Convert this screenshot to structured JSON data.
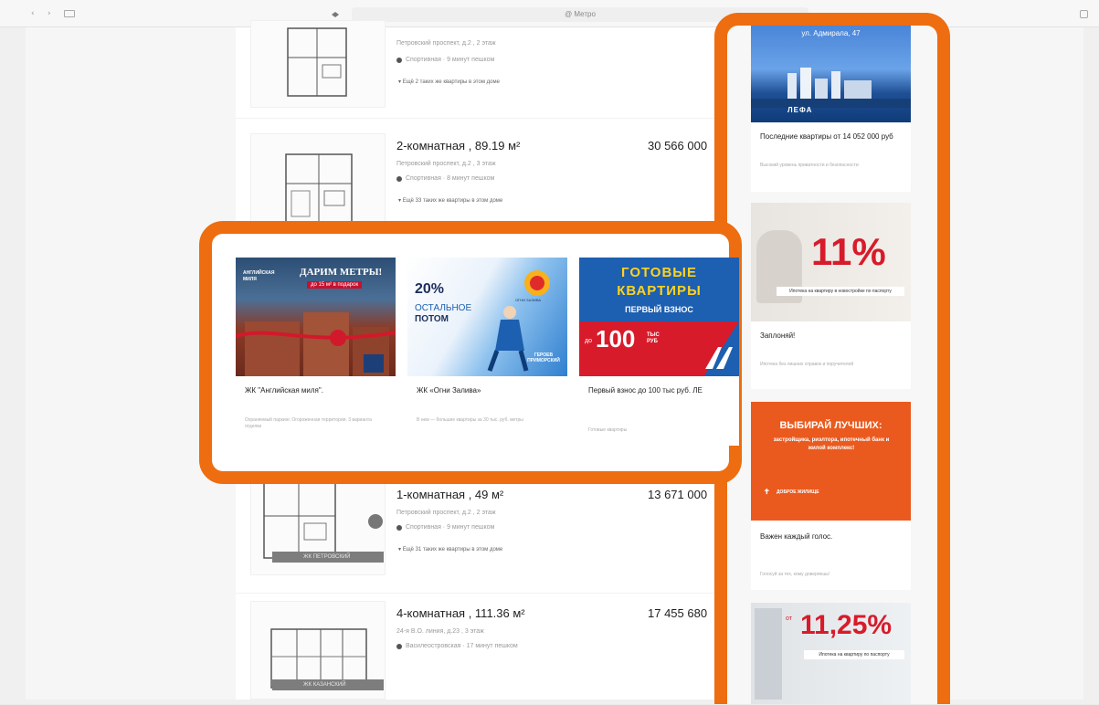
{
  "browser": {
    "address": "@ Метро"
  },
  "listings": [
    {
      "title": "",
      "price": "",
      "address": "Петровский проспект, д.2 , 2 этаж",
      "metro": "Спортивная · 9 минут пешком",
      "more": "Ещё 2 таких же квартиры в этом доме"
    },
    {
      "title": "2-комнатная , 89.19 м²",
      "price": "30 566 000",
      "address": "Петровский проспект, д.2 , 3 этаж",
      "metro": "Спортивная · 8 минут пешком",
      "more": "Ещё 33 таких же квартиры в этом доме"
    },
    {
      "title": "1-комнатная , 49 м²",
      "price": "13 671 000",
      "address": "Петровский проспект, д.2 , 2 этаж",
      "metro": "Спортивная · 9 минут пешком",
      "more": "Ещё 31 таких же квартиры в этом доме",
      "band": "ЖК ПЕТРОВСКИЙ"
    },
    {
      "title": "4-комнатная , 111.36 м²",
      "price": "17 455 680",
      "address": "24-я В.О. линия, д.23 , 3 этаж",
      "metro": "Василеостровская · 17 минут пешком",
      "more": "",
      "band": "ЖК КАЗАНСКИЙ"
    }
  ],
  "center_ads": [
    {
      "banner_left": "АНГЛИЙСКАЯ МИЛЯ",
      "banner_headline": "ДАРИМ МЕТРЫ!",
      "banner_sub": "до 15 м² в подарок",
      "caption": "ЖК \"Английская миля\".",
      "sub": "Охраняемый паркинг. Огороженная территория. 3 варианта отделки"
    },
    {
      "banner_pct": "20%",
      "banner_l1": "ОСТАЛЬНОЕ",
      "banner_l2": "ПОТОМ",
      "banner_brand": "ОГНИ ЗАЛИВА",
      "banner_foot": "ГЕРОЕВ ПРИМОРСКИЙ",
      "caption": "ЖК «Огни Залива»",
      "sub": "В нем — большие квартиры за 30 тыс. руб. метры"
    },
    {
      "banner_l1": "ГОТОВЫЕ",
      "banner_l2": "КВАРТИРЫ",
      "banner_l3": "ПЕРВЫЙ ВЗНОС",
      "banner_prefix": "до",
      "banner_amount": "100",
      "banner_unit": "ТЫС РУБ",
      "caption": "Первый взнос до 100 тыс руб. ЛЕ",
      "sub": "Готовые квартиры"
    }
  ],
  "right_ads": [
    {
      "banner_top": "ул. Адмирала, 47",
      "banner_brand": "ЛЕФА",
      "caption": "Последние квартиры от 14 052 000 руб",
      "sub": "Высокий уровень приватности и безопасности"
    },
    {
      "banner_pct": "11%",
      "banner_note": "Ипотека на квартиру в новостройке по паспорту",
      "caption": "Заплоняй!",
      "sub": "Ипотека без лишних справок и поручителей"
    },
    {
      "banner_l1": "ВЫБИРАЙ ЛУЧШИХ:",
      "banner_l2": "застройщика, риэлтора, ипотечный банк и жилой комплекс!",
      "banner_brand": "ДОБРОЕ ЖИЛИЩЕ",
      "caption": "Важен каждый голос.",
      "sub": "Голосуй за тех, кому доверяешь!"
    },
    {
      "banner_prefix": "от",
      "banner_pct": "11,25%",
      "banner_note": "Ипотека на квартиру по паспорту"
    }
  ],
  "colors": {
    "highlight": "#ee6d10",
    "red": "#d81b2a",
    "blue": "#1d5fb0"
  }
}
